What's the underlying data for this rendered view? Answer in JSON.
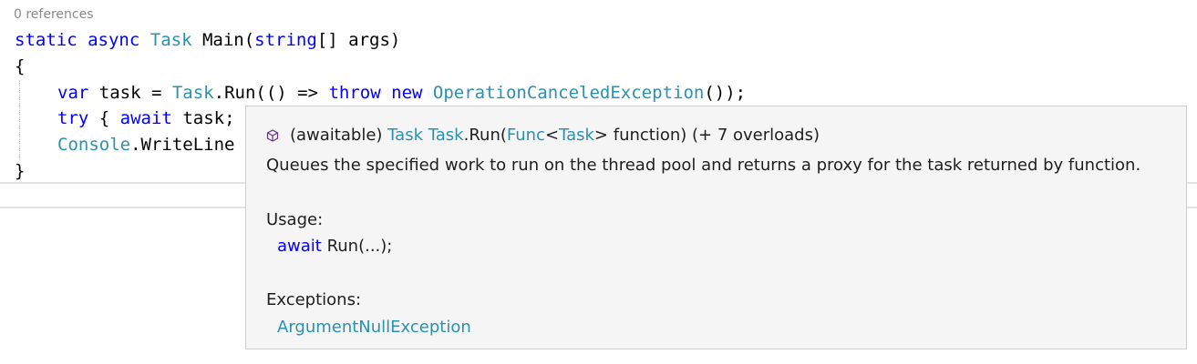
{
  "codelens": {
    "references": "0 references"
  },
  "code": {
    "line1": {
      "kw_static": "static",
      "kw_async": "async",
      "type_task": "Task",
      "rest": "Main(",
      "kw_string": "string",
      "tail": "[] args)"
    },
    "line2": {
      "text": "{"
    },
    "line3": {
      "kw_var": "var",
      "mid1": "task = ",
      "type_task": "Task",
      "mid2": ".Run(() => ",
      "kw_throw": "throw",
      "kw_new": "new",
      "type_exc": "OperationCanceledException",
      "tail": "());"
    },
    "line4": {
      "kw_try": "try",
      "mid": "{ ",
      "kw_await": "await",
      "tail": "task;"
    },
    "line5": {
      "type_console": "Console",
      "tail": ".WriteLine"
    },
    "line6": {
      "text": "}"
    }
  },
  "tooltip": {
    "icon": "method-cube-icon",
    "sig_prefix": "(awaitable)",
    "sig_return_type": "Task",
    "sig_class": "Task",
    "sig_method": ".Run(",
    "sig_param_type": "Func",
    "sig_lt": "<",
    "sig_param_generic": "Task",
    "sig_rest": "> function) (+ 7 overloads)",
    "description": "Queues the specified work to run on the thread pool and returns a proxy for the task returned by function.",
    "usage_heading": "Usage:",
    "usage_kw": "await",
    "usage_call": "Run(...);",
    "exceptions_heading": "Exceptions:",
    "exceptions": [
      "ArgumentNullException"
    ]
  },
  "colors": {
    "keyword": "#0000ff",
    "type": "#2b91af",
    "icon": "#652d90"
  }
}
